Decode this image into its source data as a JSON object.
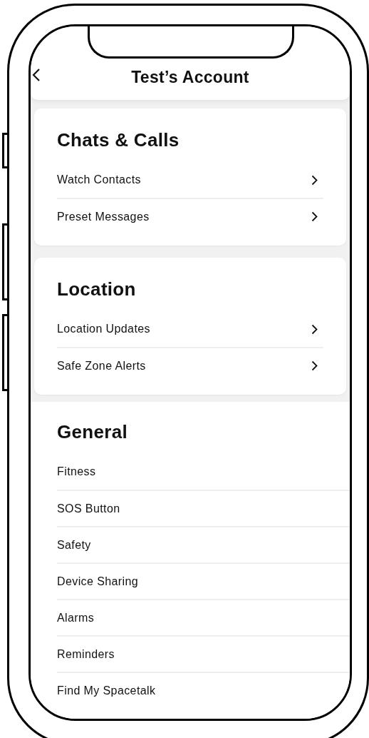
{
  "header": {
    "title": "Test’s Account"
  },
  "sections": [
    {
      "kind": "card",
      "title": "Chats & Calls",
      "items": [
        "Watch Contacts",
        "Preset Messages"
      ]
    },
    {
      "kind": "card",
      "title": "Location",
      "items": [
        "Location Updates",
        "Safe Zone Alerts"
      ]
    },
    {
      "kind": "plain",
      "title": "General",
      "items": [
        "Fitness",
        "SOS Button",
        "Safety",
        "Device Sharing",
        "Alarms",
        "Reminders",
        "Find My Spacetalk"
      ]
    }
  ]
}
